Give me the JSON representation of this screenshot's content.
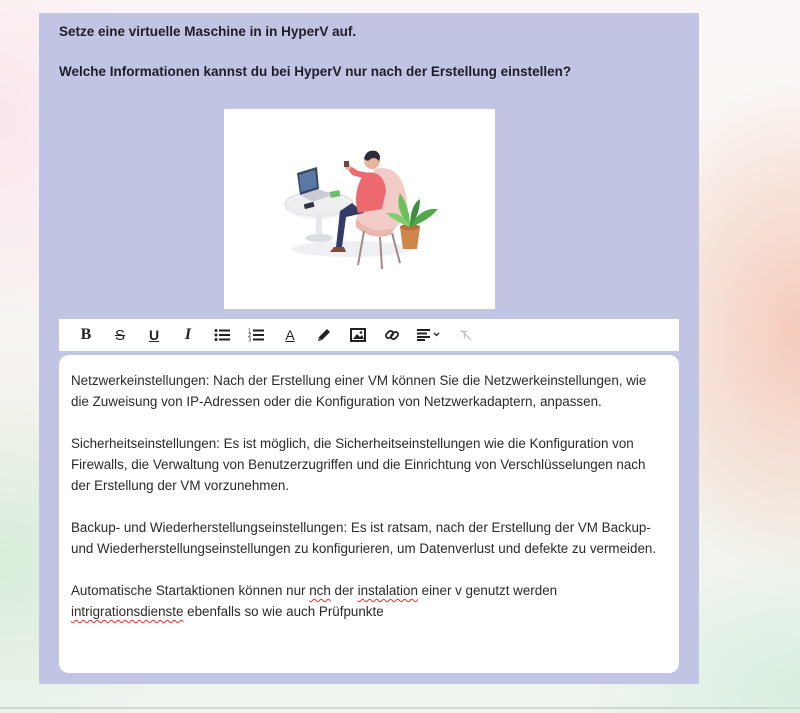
{
  "question": {
    "line1": "Setze eine virtuelle Maschine in in HyperV auf.",
    "line2": "Welche Informationen kannst du bei HyperV nur nach der Erstellung einstellen?"
  },
  "toolbar": {
    "bold": "B",
    "strikethrough": "S",
    "underline": "U",
    "italic": "I",
    "font_color": "A",
    "icons": [
      "bold-icon",
      "strikethrough-icon",
      "underline-icon",
      "italic-icon",
      "bulleted-list-icon",
      "numbered-list-icon",
      "font-color-icon",
      "pen-icon",
      "image-icon",
      "link-icon",
      "align-icon",
      "clear-format-icon"
    ]
  },
  "answer": {
    "p1": "Netzwerkeinstellungen: Nach der Erstellung einer VM können Sie die Netzwerkeinstellungen, wie die Zuweisung von IP-Adressen oder die Konfiguration von Netzwerkadaptern, anpassen.",
    "p2": "Sicherheitseinstellungen: Es ist möglich, die Sicherheitseinstellungen wie die Konfiguration von Firewalls, die Verwaltung von Benutzerzugriffen und die Einrichtung von Verschlüsselungen nach der Erstellung der VM vorzunehmen.",
    "p3": "Backup- und Wiederherstellungseinstellungen: Es ist ratsam, nach der Erstellung der VM Backup- und Wiederherstellungseinstellungen zu konfigurieren, um Datenverlust und defekte zu vermeiden.",
    "p4": {
      "t1": "Automatische Startaktionen können nur ",
      "err1": "nch",
      "t2": " der ",
      "err2": "instalation",
      "t3": " einer v genutzt werden ",
      "err3": "intrigrationsdienste",
      "t4": " ebenfalls  so wie auch Prüfpunkte"
    }
  },
  "colors": {
    "card_background": "#c2c4e3",
    "spellcheck_underline": "#e0302a"
  }
}
